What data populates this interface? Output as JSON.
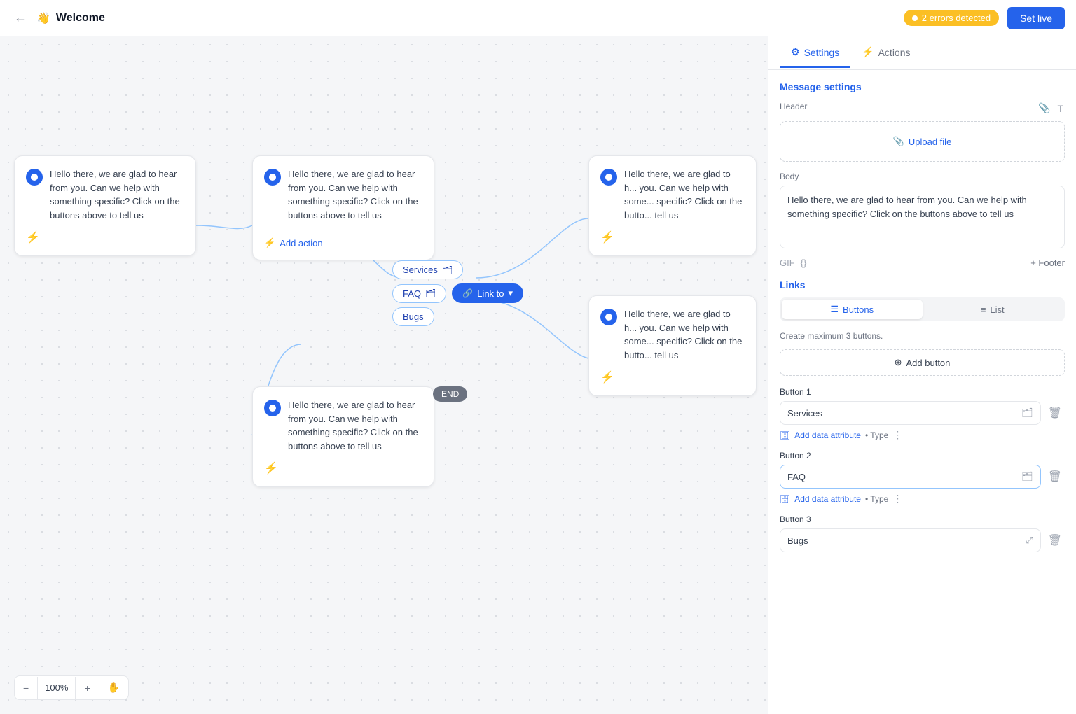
{
  "topbar": {
    "back_icon": "←",
    "page_emoji": "👋",
    "title": "Welcome",
    "errors_count": "2 errors detected",
    "set_live_label": "Set live"
  },
  "panel_tabs": {
    "settings_label": "Settings",
    "actions_label": "Actions"
  },
  "panel": {
    "message_settings_title": "Message settings",
    "header_label": "Header",
    "upload_file_label": "Upload file",
    "body_label": "Body",
    "body_text": "Hello there, we are glad to hear from you. Can we help with something specific? Click on the buttons above to tell us",
    "gif_label": "GIF",
    "code_label": "{}",
    "footer_label": "+ Footer",
    "links_title": "Links",
    "buttons_label": "Buttons",
    "list_label": "List",
    "create_max_text": "Create maximum 3 buttons.",
    "add_button_circle": "⊕",
    "add_button_label": "Add button",
    "button1_label": "Button 1",
    "button1_value": "Services",
    "button2_label": "Button 2",
    "button2_value": "FAQ",
    "button3_label": "Button 3",
    "button3_value": "Bugs",
    "add_data_attr_label": "Add data attribute",
    "type_label": "• Type"
  },
  "canvas": {
    "nodes": [
      {
        "id": "node1",
        "text": "Hello there, we are glad to hear from you. Can we help with something specific? Click on the buttons above to tell us"
      },
      {
        "id": "node2",
        "text": "Hello there, we are glad to hear from you. Can we help with something specific? Click on the buttons above to tell us"
      },
      {
        "id": "node3",
        "text": "Hello there, we are glad to hear from you. Can we help with some specific? Click on the button tell us"
      },
      {
        "id": "node4",
        "text": "Hello there, we are glad to hear from you. Can we help with some specific? Click on the button tell us"
      },
      {
        "id": "node5",
        "text": "Hello there, we are glad to hear from you. Can we help with something specific? Click on the buttons above to tell us"
      }
    ],
    "chips": [
      "Services",
      "FAQ",
      "Bugs"
    ],
    "end_label": "END",
    "add_action_label": "Add action",
    "link_to_label": "Link to",
    "zoom_minus": "−",
    "zoom_value": "100%",
    "zoom_plus": "+",
    "hand_icon": "✋"
  }
}
